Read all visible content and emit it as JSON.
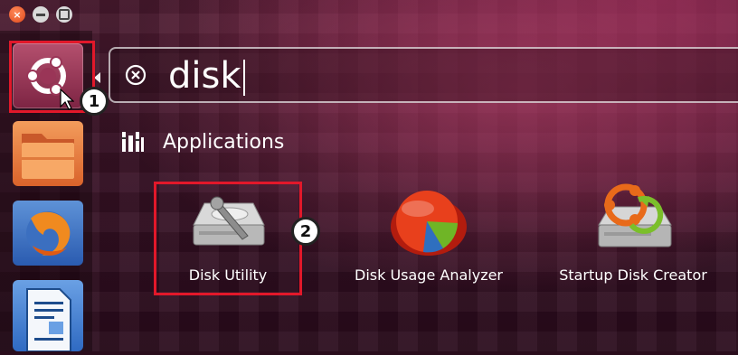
{
  "window_controls": {
    "close_symbol": "×",
    "icons": [
      "close-icon",
      "minimize-icon",
      "maximize-icon"
    ]
  },
  "launcher": {
    "items": [
      {
        "name": "ubuntu-home-icon"
      },
      {
        "name": "files-icon"
      },
      {
        "name": "firefox-icon"
      },
      {
        "name": "libreoffice-writer-icon"
      }
    ]
  },
  "annotations": {
    "step1": "1",
    "step2": "2",
    "highlight_color": "#e2182a"
  },
  "search": {
    "value": "disk",
    "clear_icon": "clear-icon"
  },
  "section": {
    "title": "Applications",
    "icon": "applications-icon"
  },
  "apps": [
    {
      "label": "Disk Utility",
      "icon": "disk-utility-icon"
    },
    {
      "label": "Disk Usage Analyzer",
      "icon": "disk-usage-analyzer-icon"
    },
    {
      "label": "Startup Disk Creator",
      "icon": "startup-disk-creator-icon"
    }
  ]
}
